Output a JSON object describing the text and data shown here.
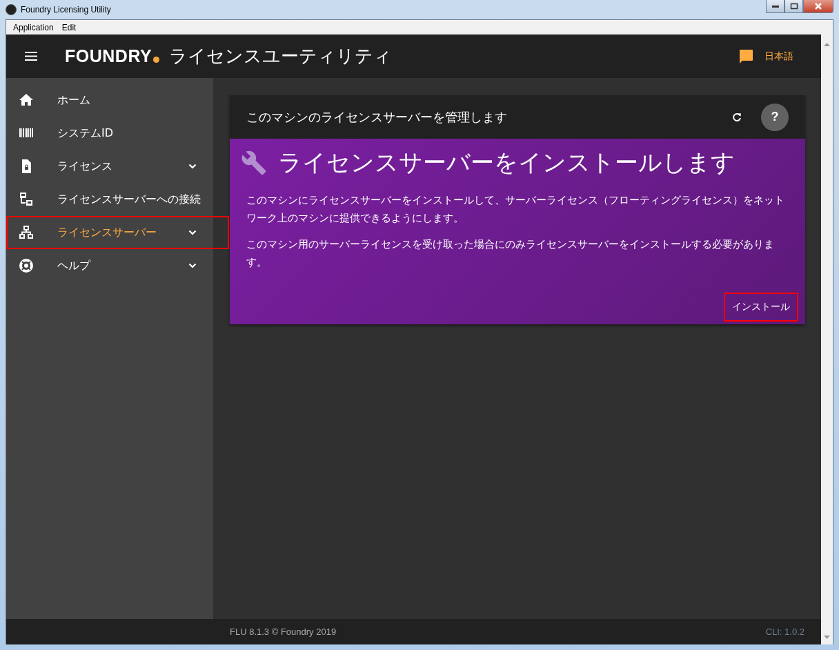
{
  "window": {
    "title": "Foundry Licensing Utility"
  },
  "menu_bar": [
    "Application",
    "Edit"
  ],
  "header": {
    "brand": "FOUNDRY",
    "title": "ライセンスユーティリティ",
    "language": "日本語"
  },
  "sidebar": {
    "items": [
      {
        "label": "ホーム",
        "has_submenu": false,
        "selected": false,
        "annotated": false
      },
      {
        "label": "システムID",
        "has_submenu": false,
        "selected": false,
        "annotated": false
      },
      {
        "label": "ライセンス",
        "has_submenu": true,
        "selected": false,
        "annotated": false
      },
      {
        "label": "ライセンスサーバーへの接続",
        "has_submenu": false,
        "selected": false,
        "annotated": false
      },
      {
        "label": "ライセンスサーバー",
        "has_submenu": true,
        "selected": true,
        "annotated": true
      },
      {
        "label": "ヘルプ",
        "has_submenu": true,
        "selected": false,
        "annotated": false
      }
    ]
  },
  "card": {
    "title": "このマシンのライセンスサーバーを管理します",
    "help": "?",
    "heading": "ライセンスサーバーをインストールします",
    "paragraphs": [
      "このマシンにライセンスサーバーをインストールして、サーバーライセンス（フローティングライセンス）をネットワーク上のマシンに提供できるようにします。",
      "このマシン用のサーバーライセンスを受け取った場合にのみライセンスサーバーをインストールする必要があります。"
    ],
    "button": {
      "label": "インストール",
      "annotated": true
    }
  },
  "footer": {
    "version": "FLU 8.1.3 © Foundry 2019",
    "cli": "CLI: 1.0.2"
  }
}
